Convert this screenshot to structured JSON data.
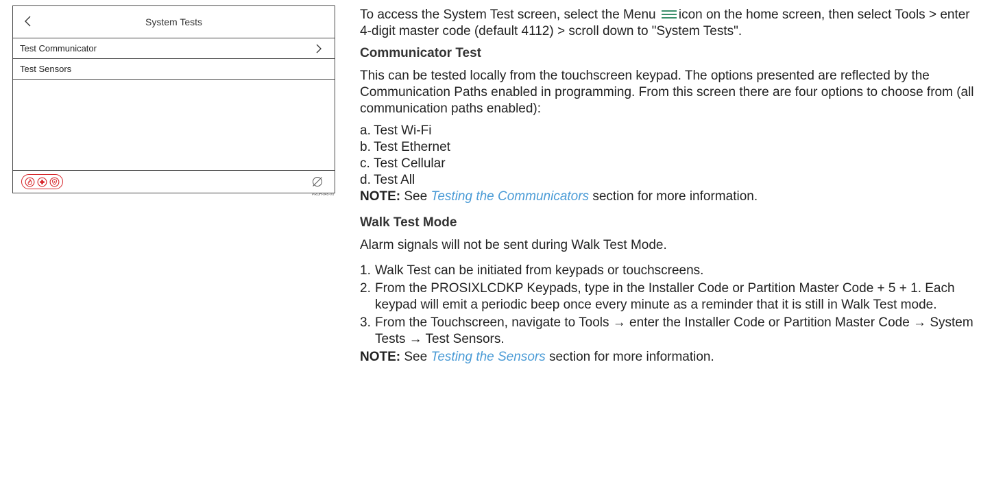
{
  "device": {
    "title": "System Tests",
    "rows": [
      {
        "label": "Test Communicator"
      },
      {
        "label": "Test Sensors"
      }
    ],
    "part_code": "PROH-045-V0"
  },
  "doc": {
    "intro_before_icon": "To access the System Test screen, select the Menu",
    "intro_after_icon": "icon on the home screen, then select Tools > enter 4-digit master code (default 4112) > scroll down to \"System Tests\".",
    "comm": {
      "heading": "Communicator Test",
      "body": "This can be tested locally from the touchscreen keypad.  The options presented are reflected by the Communication Paths enabled in programming.  From this screen there are four options to choose from (all communication paths enabled):",
      "options": [
        {
          "label": "a.",
          "text": "Test Wi-Fi"
        },
        {
          "label": "b.",
          "text": "Test Ethernet"
        },
        {
          "label": "c.",
          "text": "Test Cellular"
        },
        {
          "label": "d.",
          "text": "Test All"
        }
      ],
      "note_label": "NOTE:",
      "note_before": " See ",
      "note_link": "Testing the Communicators",
      "note_after": " section for more information."
    },
    "walk": {
      "heading": "Walk Test Mode",
      "body": "Alarm signals will not be sent during Walk Test Mode.",
      "steps": [
        {
          "num": "1.",
          "text": "Walk Test can be initiated from keypads or touchscreens."
        },
        {
          "num": "2.",
          "text": "From the PROSIXLCDKP Keypads, type in the Installer Code or Partition Master Code + 5 + 1.  Each keypad will emit a periodic beep once every minute as a reminder that it is still in Walk Test mode."
        }
      ],
      "step3": {
        "num": "3.",
        "part1": "From the Touchscreen, navigate to Tools ",
        "part2": " enter the Installer Code or Partition Master Code ",
        "part3": " System Tests ",
        "part4": " Test Sensors.",
        "arrow": "→"
      },
      "note_label": "NOTE:",
      "note_before": " See ",
      "note_link": "Testing the Sensors",
      "note_after": " section for more information."
    }
  },
  "colors": {
    "link": "#4a9bd6",
    "emergency": "#d6262b"
  },
  "icons": [
    "chevron-left-icon",
    "chevron-right-icon",
    "fire-icon",
    "medical-cross-icon",
    "police-badge-icon",
    "no-sign-icon",
    "menu-icon"
  ]
}
